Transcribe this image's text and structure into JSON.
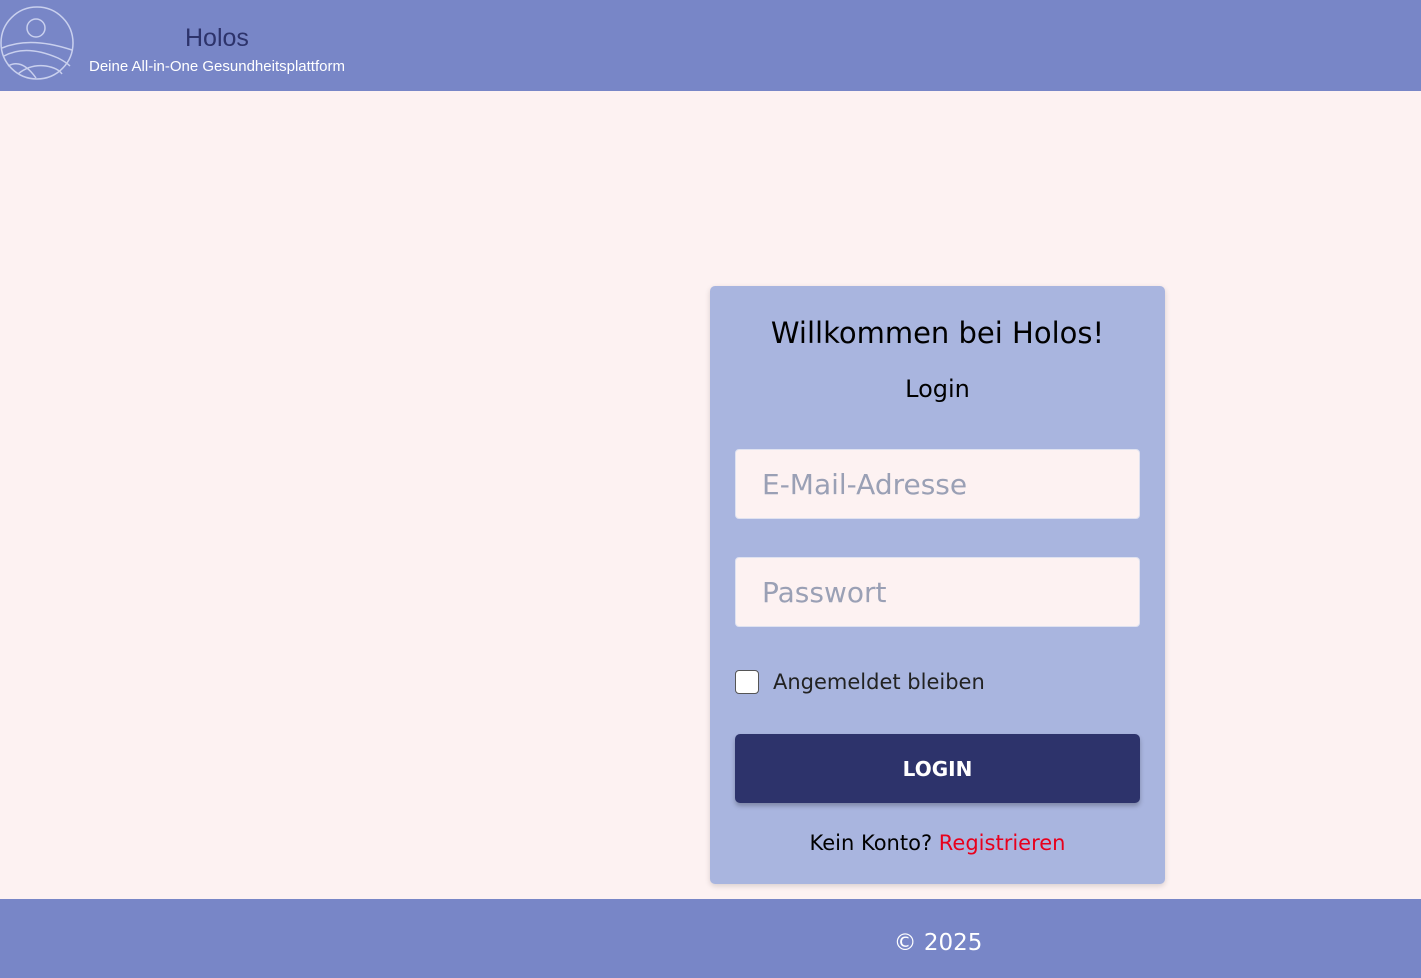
{
  "header": {
    "logo_icon": "sun-over-hills-icon",
    "title": "Holos",
    "subtitle": "Deine All-in-One Gesundheitsplattform"
  },
  "login_card": {
    "welcome": "Willkommen bei Holos!",
    "heading": "Login",
    "email_placeholder": "E-Mail-Adresse",
    "email_value": "",
    "password_placeholder": "Passwort",
    "password_value": "",
    "remember_label": "Angemeldet bleiben",
    "remember_checked": false,
    "login_button": "LOGIN",
    "signup_prompt": "Kein Konto?",
    "signup_link": "Registrieren"
  },
  "footer": {
    "copyright": "© 2025"
  },
  "colors": {
    "header_bg": "#7886c7",
    "page_bg": "#fdf2f2",
    "card_bg": "#a9b5df",
    "button_bg": "#2d336b",
    "link": "#e8001c"
  }
}
